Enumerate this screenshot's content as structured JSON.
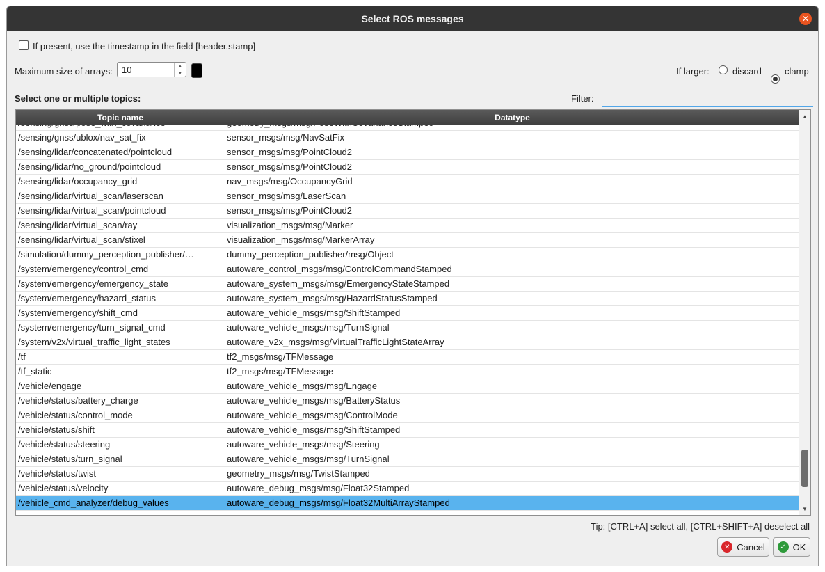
{
  "dialog": {
    "title": "Select ROS messages",
    "close_icon": "close-icon"
  },
  "options": {
    "timestamp_label": "If present, use the timestamp in the field [header.stamp]",
    "timestamp_checked": false,
    "max_arrays_label": "Maximum size of arrays:",
    "max_arrays_value": "10",
    "if_larger_label": "If larger:",
    "discard_label": "discard",
    "clamp_label": "clamp",
    "selected_option": "clamp"
  },
  "topics": {
    "heading": "Select one or multiple topics:",
    "filter_label": "Filter:",
    "filter_value": "",
    "columns": [
      "Topic name",
      "Datatype"
    ],
    "rows": [
      [
        "/sensing/gnss/pose_with_covariance",
        "geometry_msgs/msg/PoseWithCovarianceStamped"
      ],
      [
        "/sensing/gnss/ublox/nav_sat_fix",
        "sensor_msgs/msg/NavSatFix"
      ],
      [
        "/sensing/lidar/concatenated/pointcloud",
        "sensor_msgs/msg/PointCloud2"
      ],
      [
        "/sensing/lidar/no_ground/pointcloud",
        "sensor_msgs/msg/PointCloud2"
      ],
      [
        "/sensing/lidar/occupancy_grid",
        "nav_msgs/msg/OccupancyGrid"
      ],
      [
        "/sensing/lidar/virtual_scan/laserscan",
        "sensor_msgs/msg/LaserScan"
      ],
      [
        "/sensing/lidar/virtual_scan/pointcloud",
        "sensor_msgs/msg/PointCloud2"
      ],
      [
        "/sensing/lidar/virtual_scan/ray",
        "visualization_msgs/msg/Marker"
      ],
      [
        "/sensing/lidar/virtual_scan/stixel",
        "visualization_msgs/msg/MarkerArray"
      ],
      [
        "/simulation/dummy_perception_publisher/…",
        "dummy_perception_publisher/msg/Object"
      ],
      [
        "/system/emergency/control_cmd",
        "autoware_control_msgs/msg/ControlCommandStamped"
      ],
      [
        "/system/emergency/emergency_state",
        "autoware_system_msgs/msg/EmergencyStateStamped"
      ],
      [
        "/system/emergency/hazard_status",
        "autoware_system_msgs/msg/HazardStatusStamped"
      ],
      [
        "/system/emergency/shift_cmd",
        "autoware_vehicle_msgs/msg/ShiftStamped"
      ],
      [
        "/system/emergency/turn_signal_cmd",
        "autoware_vehicle_msgs/msg/TurnSignal"
      ],
      [
        "/system/v2x/virtual_traffic_light_states",
        "autoware_v2x_msgs/msg/VirtualTrafficLightStateArray"
      ],
      [
        "/tf",
        "tf2_msgs/msg/TFMessage"
      ],
      [
        "/tf_static",
        "tf2_msgs/msg/TFMessage"
      ],
      [
        "/vehicle/engage",
        "autoware_vehicle_msgs/msg/Engage"
      ],
      [
        "/vehicle/status/battery_charge",
        "autoware_vehicle_msgs/msg/BatteryStatus"
      ],
      [
        "/vehicle/status/control_mode",
        "autoware_vehicle_msgs/msg/ControlMode"
      ],
      [
        "/vehicle/status/shift",
        "autoware_vehicle_msgs/msg/ShiftStamped"
      ],
      [
        "/vehicle/status/steering",
        "autoware_vehicle_msgs/msg/Steering"
      ],
      [
        "/vehicle/status/turn_signal",
        "autoware_vehicle_msgs/msg/TurnSignal"
      ],
      [
        "/vehicle/status/twist",
        "geometry_msgs/msg/TwistStamped"
      ],
      [
        "/vehicle/status/velocity",
        "autoware_debug_msgs/msg/Float32Stamped"
      ],
      [
        "/vehicle_cmd_analyzer/debug_values",
        "autoware_debug_msgs/msg/Float32MultiArrayStamped"
      ]
    ],
    "selected_index": 26
  },
  "scroll": {
    "thumb_start": 0.86,
    "thumb_fraction": 0.1
  },
  "footer": {
    "tip": "Tip: [CTRL+A] select all, [CTRL+SHIFT+A] deselect all",
    "cancel_label": "Cancel",
    "ok_label": "OK"
  },
  "colors": {
    "titlebar": "#343434",
    "close_button": "#e95420",
    "selection": "#59b3ee",
    "filter_underline": "#52a6e8",
    "cancel_icon": "#d9262b",
    "ok_icon": "#2e9a3a"
  }
}
